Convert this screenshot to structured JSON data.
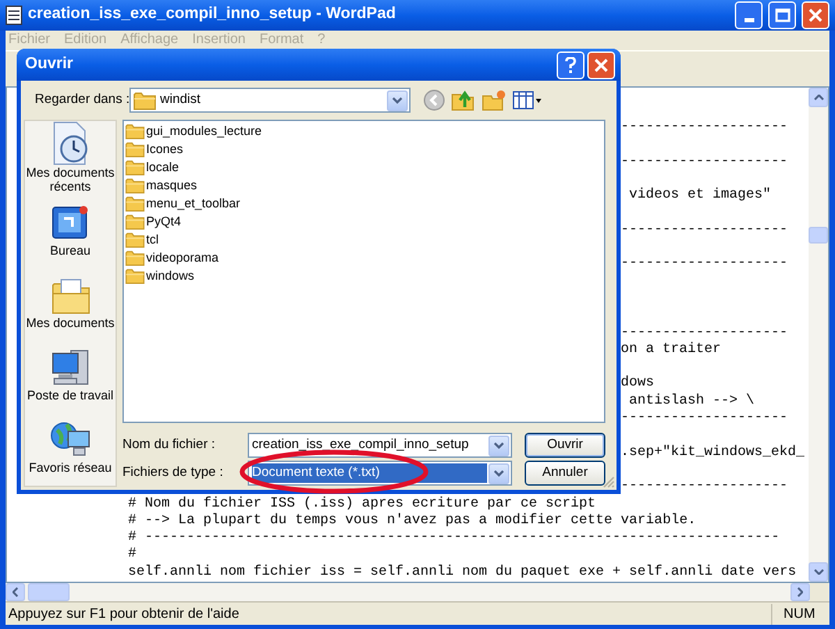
{
  "window": {
    "title": "creation_iss_exe_compil_inno_setup - WordPad"
  },
  "menu": [
    {
      "label": "Fichier",
      "disabled": true
    },
    {
      "label": "Edition",
      "disabled": true
    },
    {
      "label": "Affichage",
      "disabled": true
    },
    {
      "label": "Insertion",
      "disabled": true
    },
    {
      "label": "Format",
      "disabled": true
    },
    {
      "label": "?",
      "disabled": true
    }
  ],
  "document": {
    "lines": [
      {
        "kind": "right",
        "text": "--------------------"
      },
      {
        "kind": "covered"
      },
      {
        "kind": "right",
        "text": "--------------------"
      },
      {
        "kind": "covered"
      },
      {
        "kind": "right",
        "text": " videos et images\""
      },
      {
        "kind": "covered"
      },
      {
        "kind": "right",
        "text": "--------------------"
      },
      {
        "kind": "covered"
      },
      {
        "kind": "right",
        "text": "--------------------"
      },
      {
        "kind": "covered"
      },
      {
        "kind": "covered"
      },
      {
        "kind": "covered"
      },
      {
        "kind": "right",
        "text": "--------------------"
      },
      {
        "kind": "right",
        "text": "on a traiter"
      },
      {
        "kind": "covered"
      },
      {
        "kind": "right",
        "text": "dows"
      },
      {
        "kind": "right",
        "text": " antislash --> \\"
      },
      {
        "kind": "right",
        "text": "--------------------"
      },
      {
        "kind": "covered"
      },
      {
        "kind": "right",
        "text": ".sep+\"kit_windows_ekd_"
      },
      {
        "kind": "covered"
      },
      {
        "kind": "right",
        "text": "--------------------"
      },
      {
        "kind": "full",
        "text": "# Nom du fichier ISS (.iss) apres ecriture par ce script"
      },
      {
        "kind": "full",
        "text": "# --> La plupart du temps vous n'avez pas a modifier cette variable."
      },
      {
        "kind": "full",
        "text": "# ----------------------------------------------------------------------------"
      },
      {
        "kind": "full",
        "text": "#"
      },
      {
        "kind": "full",
        "text": "self.annli nom fichier iss = self.annli nom du paquet exe + self.annli date vers"
      }
    ]
  },
  "status_bar": {
    "message": "Appuyez sur F1 pour obtenir de l'aide",
    "indicator": "NUM"
  },
  "dialog": {
    "title": "Ouvrir",
    "look_in": {
      "label": "Regarder dans :",
      "value": "windist"
    },
    "places": [
      {
        "kind": "recent",
        "label": "Mes documents récents"
      },
      {
        "kind": "desktop",
        "label": "Bureau"
      },
      {
        "kind": "documents",
        "label": "Mes documents"
      },
      {
        "kind": "computer",
        "label": "Poste de travail"
      },
      {
        "kind": "network",
        "label": "Favoris réseau"
      }
    ],
    "files": [
      "gui_modules_lecture",
      "Icones",
      "locale",
      "masques",
      "menu_et_toolbar",
      "PyQt4",
      "tcl",
      "videoporama",
      "windows"
    ],
    "file_name": {
      "label": "Nom du fichier :",
      "value": "creation_iss_exe_compil_inno_setup"
    },
    "file_type": {
      "label": "Fichiers de type :",
      "value": "Document texte (*.txt)",
      "selected": true
    },
    "buttons": [
      "Ouvrir",
      "Annuler"
    ]
  }
}
